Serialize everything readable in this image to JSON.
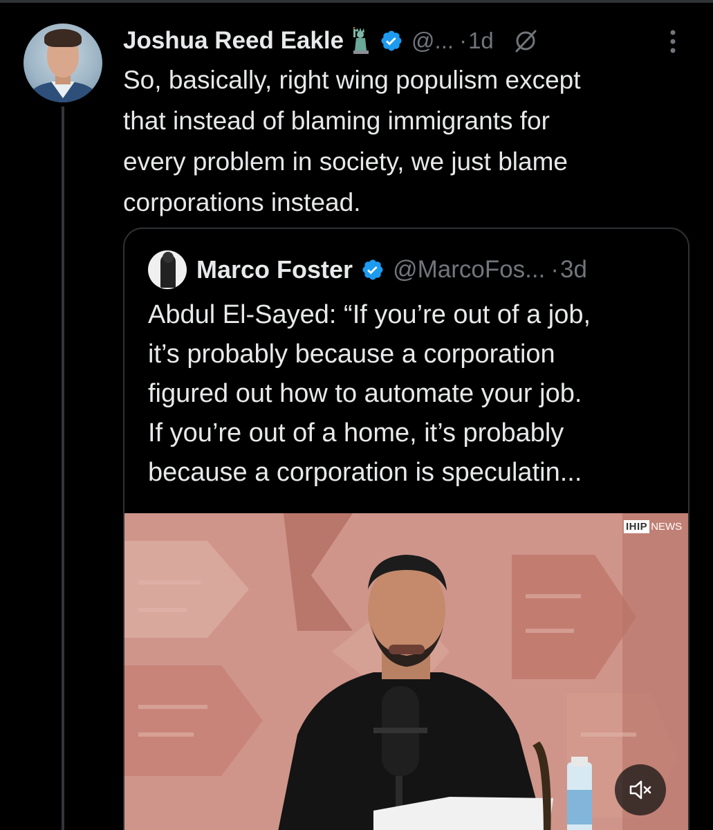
{
  "tweet": {
    "author": {
      "display_name": "Joshua Reed Eakle",
      "emoji": "statue-of-liberty",
      "verified": true,
      "handle": "@...",
      "avatar": "avatar-photo"
    },
    "separator": "·",
    "timestamp": "1d",
    "text": "So, basically, right wing populism except\nthat instead of blaming immigrants for\nevery problem in society, we just blame\ncorporations instead.",
    "icons": [
      "grok-icon",
      "more-icon"
    ]
  },
  "quote": {
    "author": {
      "display_name": "Marco Foster",
      "verified": true,
      "handle": "@MarcoFos...",
      "avatar": "avatar-photo"
    },
    "separator": "·",
    "timestamp": "3d",
    "text": "Abdul El-Sayed: “If you’re out of a job,\nit’s probably because a corporation\nfigured out how to automate your job.\nIf you’re out of a home, it’s probably\nbecause a corporation is speculatin...",
    "video": {
      "watermark_box": "IHIP",
      "watermark_text": "NEWS",
      "mute_icon": "speaker-muted-icon"
    }
  },
  "colors": {
    "background": "#000000",
    "text_primary": "#e7e9ea",
    "text_secondary": "#71767b",
    "verified_blue": "#1d9bf0",
    "border": "#2f3336"
  }
}
